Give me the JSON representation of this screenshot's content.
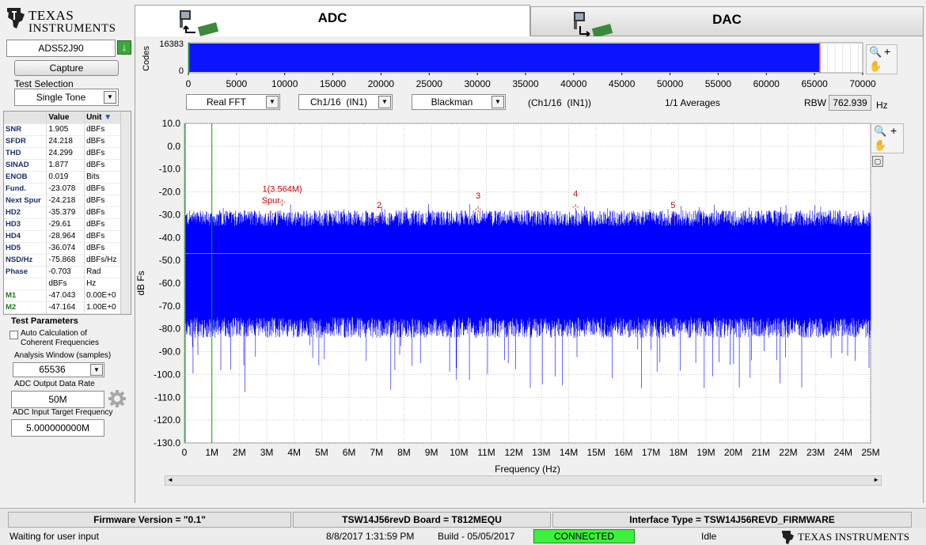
{
  "logo": {
    "line1": "Texas",
    "line2": "Instruments"
  },
  "tabs": {
    "adc": "ADC",
    "dac": "DAC"
  },
  "device": {
    "name": "ADS52J90"
  },
  "capture_label": "Capture",
  "test_selection": {
    "label": "Test Selection",
    "value": "Single Tone"
  },
  "meas_table": {
    "headers": [
      "Value",
      "Unit"
    ],
    "rows": [
      [
        "SNR",
        "1.905",
        "dBFs"
      ],
      [
        "SFDR",
        "24.218",
        "dBFs"
      ],
      [
        "THD",
        "24.299",
        "dBFs"
      ],
      [
        "SINAD",
        "1.877",
        "dBFs"
      ],
      [
        "ENOB",
        "0.019",
        "Bits"
      ],
      [
        "Fund.",
        "-23.078",
        "dBFs"
      ],
      [
        "Next Spur",
        "-24.218",
        "dBFs"
      ],
      [
        "HD2",
        "-35.379",
        "dBFs"
      ],
      [
        "HD3",
        "-29.61",
        "dBFs"
      ],
      [
        "HD4",
        "-28.964",
        "dBFs"
      ],
      [
        "HD5",
        "-36.074",
        "dBFs"
      ],
      [
        "NSD/Hz",
        "-75.868",
        "dBFs/Hz"
      ],
      [
        "Phase",
        "-0.703",
        "Rad"
      ],
      [
        "",
        "dBFs",
        "Hz"
      ],
      [
        "M1",
        "-47.043",
        "0.00E+0"
      ],
      [
        "M2",
        "-47.164",
        "1.00E+0"
      ]
    ]
  },
  "test_params": {
    "title": "Test Parameters",
    "auto_calc": "Auto Calculation of Coherent Frequencies",
    "window_label": "Analysis Window (samples)",
    "window_value": "65536",
    "rate_label": "ADC Output Data Rate",
    "rate_value": "50M",
    "target_label": "ADC Input Target Frequency",
    "target_value": "5.000000000M"
  },
  "controls": {
    "fft_type": "Real FFT",
    "channel": "Ch1/16  (IN1)",
    "window": "Blackman",
    "channel_readout": "(Ch1/16  (IN1))",
    "averages": "1/1 Averages",
    "rbw_label": "RBW",
    "rbw_value": "762.939",
    "rbw_unit": "Hz"
  },
  "time_plot": {
    "ylabel": "Codes",
    "yticks": [
      "16383",
      "0"
    ],
    "xticks": [
      "0",
      "5000",
      "10000",
      "15000",
      "20000",
      "25000",
      "30000",
      "35000",
      "40000",
      "45000",
      "50000",
      "55000",
      "60000",
      "65000",
      "70000"
    ]
  },
  "chart_data": {
    "type": "line",
    "xlabel": "Frequency (Hz)",
    "ylabel": "dB Fs",
    "xlim": [
      0,
      25
    ],
    "ylim": [
      -130,
      10
    ],
    "xticks": [
      "0",
      "1M",
      "2M",
      "3M",
      "4M",
      "5M",
      "6M",
      "7M",
      "8M",
      "9M",
      "10M",
      "11M",
      "12M",
      "13M",
      "14M",
      "15M",
      "16M",
      "17M",
      "18M",
      "19M",
      "20M",
      "21M",
      "22M",
      "23M",
      "24M",
      "25M"
    ],
    "yticks": [
      "10.0",
      "0.0",
      "-10.0",
      "-20.0",
      "-30.0",
      "-40.0",
      "-50.0",
      "-60.0",
      "-70.0",
      "-80.0",
      "-90.0",
      "-100.0",
      "-110.0",
      "-120.0",
      "-130.0"
    ],
    "noise_floor_db": -47,
    "noise_band_db": [
      -32,
      -75
    ],
    "marker_x": 1,
    "annotations": [
      {
        "text": "1(3.564M)",
        "x": 3.564,
        "y": -20
      },
      {
        "text": "Spur",
        "x": 3.15,
        "y": -25
      },
      {
        "text": "2",
        "x": 7.1,
        "y": -27
      },
      {
        "text": "3",
        "x": 10.7,
        "y": -23
      },
      {
        "text": "4",
        "x": 14.25,
        "y": -22
      },
      {
        "text": "5",
        "x": 17.8,
        "y": -27
      }
    ],
    "colors": {
      "trace": "#0000ff",
      "marker": "#00aa00",
      "harmonic": "#cc0000",
      "floor": "#e06060"
    }
  },
  "status": {
    "firmware": "Firmware Version = \"0.1\"",
    "board": "TSW14J56revD Board = T812MEQU",
    "interface": "Interface Type = TSW14J56REVD_FIRMWARE",
    "message": "Waiting for user input",
    "datetime": "8/8/2017 1:31:59 PM",
    "build": "Build  - 05/05/2017",
    "connection": "CONNECTED",
    "state": "Idle",
    "brand": "Texas Instruments"
  }
}
